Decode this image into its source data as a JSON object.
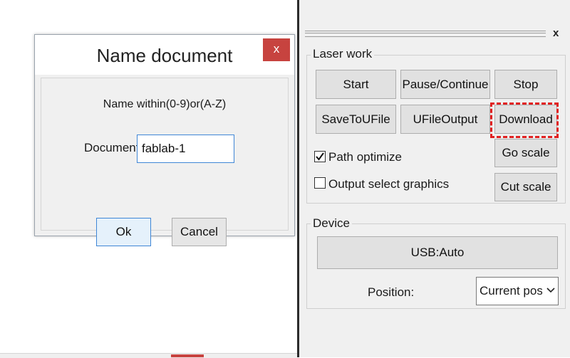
{
  "dialog": {
    "title": "Name document",
    "close_label": "x",
    "hint": "Name within(0-9)or(A-Z)",
    "document_label": "Document",
    "document_value": "fablab-1",
    "ok_label": "Ok",
    "cancel_label": "Cancel"
  },
  "panel": {
    "close_label": "x",
    "laser_work": {
      "title": "Laser work",
      "buttons": {
        "start": "Start",
        "pause": "Pause/Continue",
        "stop": "Stop",
        "save_to_ufile": "SaveToUFile",
        "ufile_output": "UFileOutput",
        "download": "Download",
        "go_scale": "Go scale",
        "cut_scale": "Cut scale"
      },
      "path_optimize": {
        "label": "Path optimize",
        "checked": true
      },
      "output_select": {
        "label": "Output select graphics",
        "checked": false
      }
    },
    "device": {
      "title": "Device",
      "usb_label": "USB:Auto",
      "position_label": "Position:",
      "position_value": "Current position"
    }
  },
  "colors": {
    "close_button": "#c7433f",
    "highlight": "#e02020",
    "focus_border": "#3f86d6"
  }
}
